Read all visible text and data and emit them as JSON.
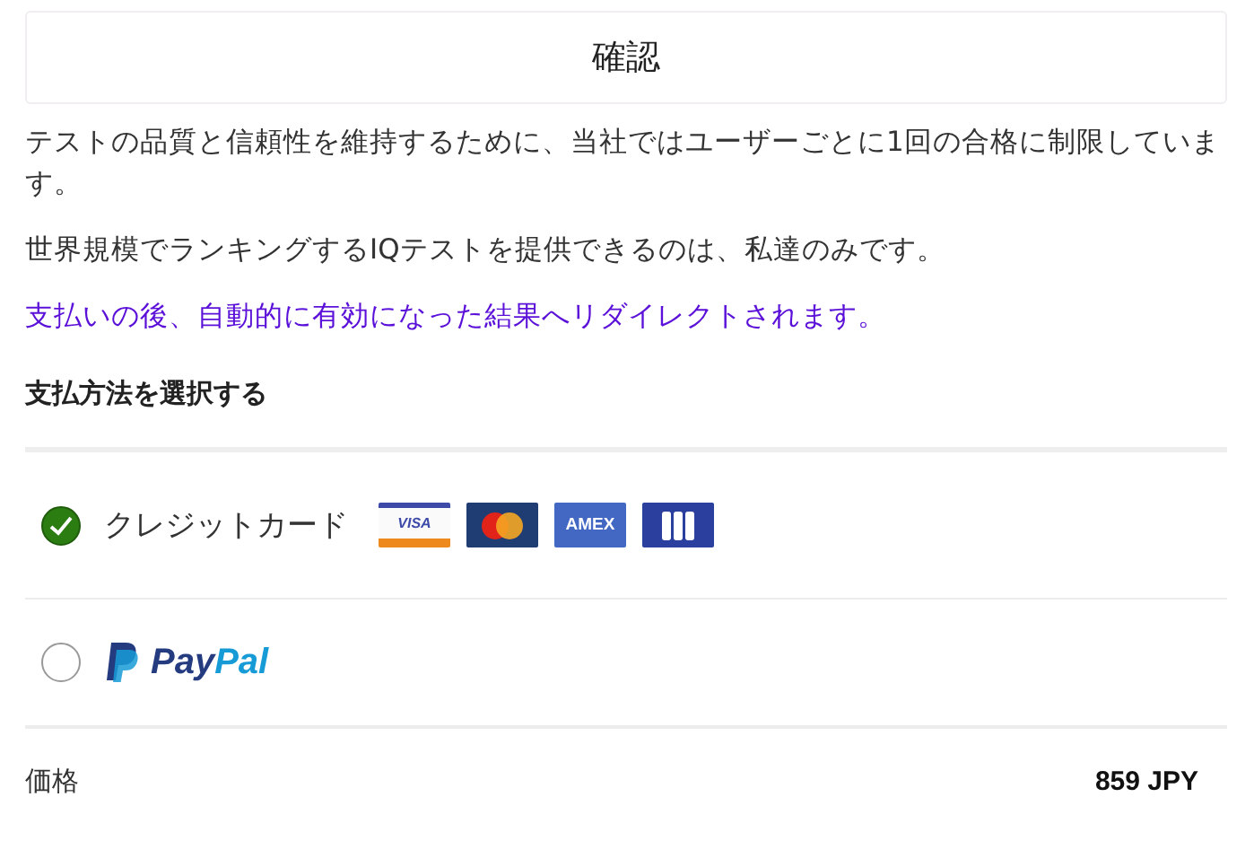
{
  "title": "確認",
  "paragraphs": [
    {
      "text": "テストの品質と信頼性を維持するために、当社ではユーザーごとに1回の合格に制限しています。",
      "kind": "plain"
    },
    {
      "text": "世界規模でランキングするIQテストを提供できるのは、私達のみです。",
      "kind": "plain"
    },
    {
      "text": "支払いの後、自動的に有効になった結果へリダイレクトされます。",
      "kind": "notice"
    }
  ],
  "payment_heading": "支払方法を選択する",
  "payment_methods": [
    {
      "kind": "card",
      "label": "クレジットカード",
      "selected": true,
      "cards": [
        {
          "kind": "visa",
          "text": "VISA"
        },
        {
          "kind": "mastercard"
        },
        {
          "kind": "amex",
          "text": "AMEX"
        },
        {
          "kind": "jcb"
        }
      ]
    },
    {
      "kind": "paypal",
      "selected": false,
      "brand": [
        "Pay",
        "Pal"
      ]
    }
  ],
  "price": {
    "label": "価格",
    "value": "859 JPY"
  }
}
